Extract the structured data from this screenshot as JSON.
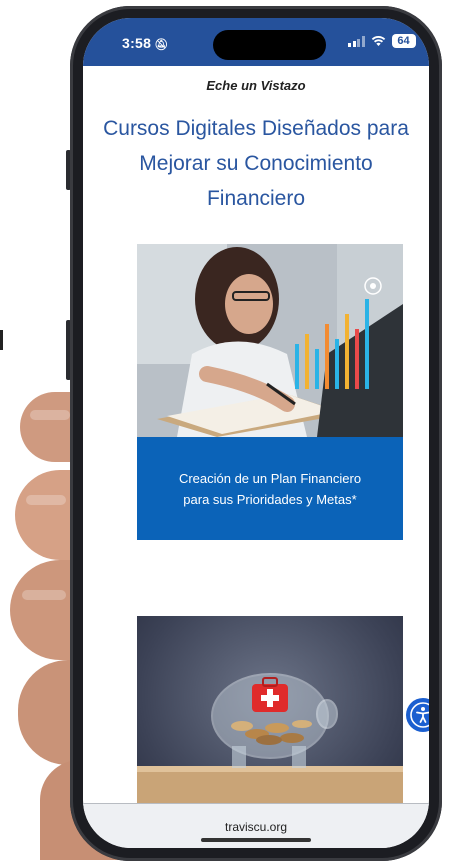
{
  "status_bar": {
    "time": "3:58",
    "silent_icon": "bell-slash-icon",
    "battery": "64"
  },
  "page": {
    "eyebrow": "Eche un Vistazo",
    "headline": "Cursos Digitales Diseñados para Mejorar su Conocimiento Financiero",
    "cards": [
      {
        "image": "woman-writing-financial-chart-photo",
        "caption": "Creación de un Plan Financiero para sus Prioridades y Metas*"
      },
      {
        "image": "piggy-bank-first-aid-photo",
        "caption": ""
      }
    ]
  },
  "browser": {
    "url": "traviscu.org"
  },
  "colors": {
    "brand_blue": "#25519b",
    "caption_blue": "#0b63b8",
    "headline_blue": "#2a56a0",
    "accessibility_blue": "#1b5fd0"
  }
}
